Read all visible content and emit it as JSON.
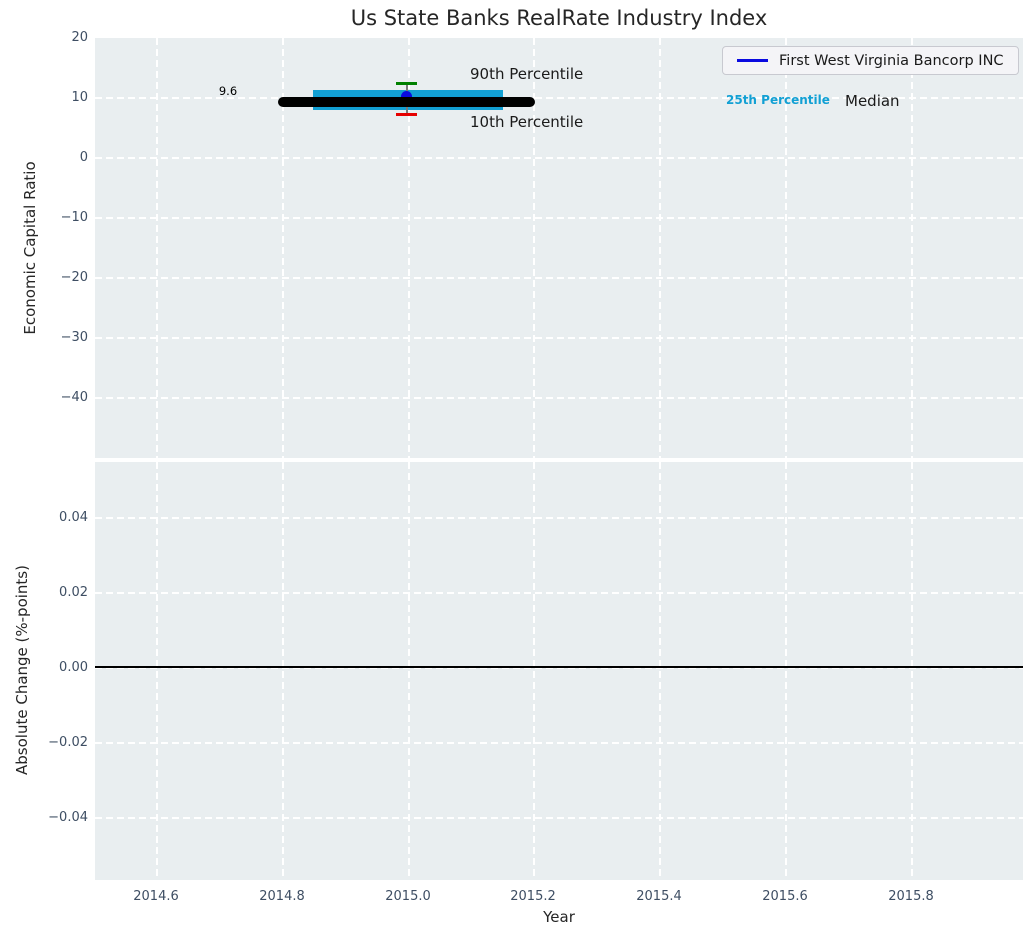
{
  "chart_data": {
    "type": "line",
    "title": "Us State Banks RealRate Industry Index",
    "x_axis": {
      "label": "Year",
      "range": [
        2014.5,
        2015.98
      ],
      "ticks": [
        2014.6,
        2014.8,
        2015.0,
        2015.2,
        2015.4,
        2015.6,
        2015.8
      ]
    },
    "subplots": [
      {
        "ylabel": "Economic Capital Ratio",
        "ylim": [
          -50,
          20
        ],
        "yticks": [
          20,
          10,
          0,
          -10,
          -20,
          -30,
          -40
        ],
        "yticklabels": [
          "20",
          "10",
          "0",
          "−10",
          "−20",
          "−30",
          "−40"
        ],
        "grid": true,
        "legend": {
          "position": "upper right",
          "label": "First West Virginia Bancorp INC",
          "color": "#0a0ae0"
        },
        "series": [
          {
            "name": "Industry median index",
            "type": "line",
            "color": "#000000",
            "linewidth": 8,
            "x": [
              2014.8,
              2015.2
            ],
            "y": [
              9.6,
              9.6
            ]
          },
          {
            "name": "25th–75th percentile band",
            "type": "band",
            "color": "#12a0d4",
            "x": [
              2014.85,
              2015.15
            ],
            "y_low": 8.1,
            "y_high": 11.2
          },
          {
            "name": "First West Virginia Bancorp INC",
            "type": "point",
            "color": "#0a0ae0",
            "x": 2015.0,
            "y": 10.2
          }
        ],
        "errorbar": {
          "x": 2015.0,
          "p90": 12.5,
          "p10": 7.3,
          "p90_color": "#008000",
          "p10_color": "#e60000",
          "line_color": "#7a7a7a"
        },
        "annotations": [
          {
            "text": "9.6",
            "x": 2014.71,
            "y": 11.2,
            "color": "#000000"
          },
          {
            "text": "90th Percentile",
            "x": 2015.2,
            "y": 14.2,
            "color": "#1a1a1a"
          },
          {
            "text": "10th Percentile",
            "x": 2015.2,
            "y": 6.2,
            "color": "#1a1a1a"
          },
          {
            "text": "25th Percentile",
            "x": 2015.58,
            "y": 9.7,
            "color": "#12a0d4"
          },
          {
            "text": "Median",
            "x": 2015.74,
            "y": 9.5,
            "color": "#000000"
          }
        ]
      },
      {
        "ylabel": "Absolute Change (%-points)",
        "xlabel": "Year",
        "ylim": [
          -0.056,
          0.055
        ],
        "yticks": [
          0.04,
          0.02,
          0.0,
          -0.02,
          -0.04
        ],
        "yticklabels": [
          "0.04",
          "0.02",
          "0.00",
          "−0.02",
          "−0.04"
        ],
        "xticklabels": [
          "2014.6",
          "2014.8",
          "2015.0",
          "2015.2",
          "2015.4",
          "2015.6",
          "2015.8"
        ],
        "grid": true,
        "series": [
          {
            "name": "zero line",
            "type": "hline",
            "color": "#000000",
            "y": 0.0
          }
        ]
      }
    ]
  }
}
